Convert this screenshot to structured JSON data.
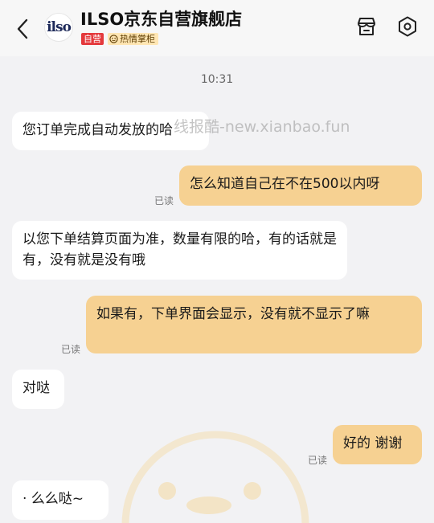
{
  "header": {
    "back_icon": "chevron-left-icon",
    "logo_text": "ilso",
    "title": "ILSO京东自营旗舰店",
    "tag_self": "自营",
    "tag_host": "热情掌柜",
    "store_icon": "store-icon",
    "settings_icon": "settings-hexagon-icon"
  },
  "chat": {
    "timestamp": "10:31",
    "watermark": "线报酷-new.xianbao.fun",
    "messages": [
      {
        "side": "in",
        "text": "您订单完成自动发放的哈"
      },
      {
        "side": "out",
        "text": "怎么知道自己在不在500以内呀",
        "status": "已读"
      },
      {
        "side": "in",
        "text": "以您下单结算页面为准，数量有限的哈，有的话就是有，没有就是没有哦"
      },
      {
        "side": "out",
        "text": "如果有，下单界面会显示，没有就不显示了嘛",
        "status": "已读"
      },
      {
        "side": "in",
        "text": "对哒"
      },
      {
        "side": "out",
        "text": "好的 谢谢",
        "status": "已读"
      },
      {
        "side": "in",
        "text": "· 么么哒~"
      }
    ]
  },
  "colors": {
    "background": "#f2f2f4",
    "incoming_bubble": "#ffffff",
    "outgoing_bubble": "#f6d192",
    "tag_self": "#e4393c",
    "tag_host": "#ffe6b3"
  }
}
